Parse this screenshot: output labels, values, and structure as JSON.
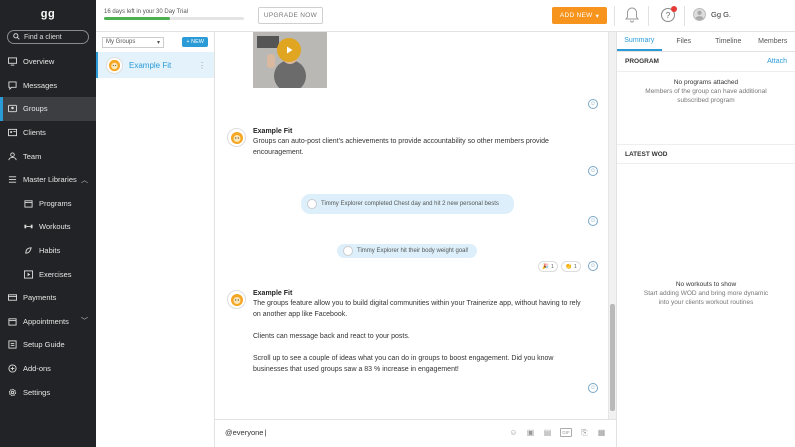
{
  "app": {
    "logo": "gg"
  },
  "nav": {
    "search_placeholder": "Find a client",
    "items": [
      {
        "label": "Overview",
        "icon": "monitor-icon"
      },
      {
        "label": "Messages",
        "icon": "chat-icon"
      },
      {
        "label": "Groups",
        "icon": "groups-icon",
        "active": true
      },
      {
        "label": "Clients",
        "icon": "id-card-icon"
      },
      {
        "label": "Team",
        "icon": "team-icon"
      },
      {
        "label": "Master Libraries",
        "icon": "library-icon",
        "expanded": true
      },
      {
        "label": "Programs",
        "icon": "calendar-icon",
        "sub": true
      },
      {
        "label": "Workouts",
        "icon": "dumbbell-icon",
        "sub": true
      },
      {
        "label": "Habits",
        "icon": "habit-icon",
        "sub": true
      },
      {
        "label": "Exercises",
        "icon": "play-icon",
        "sub": true
      },
      {
        "label": "Payments",
        "icon": "payments-icon"
      },
      {
        "label": "Appointments",
        "icon": "calendar-icon"
      },
      {
        "label": "Setup Guide",
        "icon": "guide-icon"
      },
      {
        "label": "Add-ons",
        "icon": "addons-icon"
      },
      {
        "label": "Settings",
        "icon": "gear-icon"
      }
    ]
  },
  "topbar": {
    "trial_text": "16 days left in your 30 Day Trial",
    "trial_progress": 0.47,
    "upgrade_label": "UPGRADE NOW",
    "add_new_label": "ADD NEW",
    "user_name": "Gg G."
  },
  "groups": {
    "filter_label": "My Groups",
    "new_label": "+ NEW",
    "items": [
      {
        "name": "Example Fit"
      }
    ]
  },
  "feed": {
    "posts": [
      {
        "author": "Example Fit",
        "text": "Groups can auto-post client's achievements to provide accountability so other members provide encouragement."
      },
      {
        "author": "Example Fit",
        "paragraphs": [
          "The groups feature allow you to build digital communities within your Trainerize app, without having to rely on another app like Facebook.",
          "Clients can message back and react to your posts.",
          "Scroll up to see a couple of ideas what you can do in groups to boost engagement. Did you know businesses that used groups saw a 83 % increase in engagement!"
        ]
      }
    ],
    "auto_posts": [
      {
        "text": "Timmy Explorer completed Chest day and hit 2 new personal bests"
      },
      {
        "text": "Timmy Explorer hit their body weight goal!"
      }
    ],
    "reactions": [
      {
        "emoji": "🎉",
        "count": "1"
      },
      {
        "emoji": "👏",
        "count": "1"
      }
    ]
  },
  "composer": {
    "value": "@everyone"
  },
  "right_panel": {
    "tabs": [
      "Summary",
      "Files",
      "Timeline",
      "Members"
    ],
    "active_tab": "Summary",
    "program": {
      "heading": "PROGRAM",
      "attach_label": "Attach",
      "empty_title": "No programs attached",
      "empty_body": "Members of the group can have additional subscribed program"
    },
    "wod": {
      "heading": "LATEST WOD",
      "empty_title": "No workouts to show",
      "empty_body": "Start adding WOD and bring more dynamic into your clients workout routines"
    }
  },
  "colors": {
    "accent": "#2b9bd8",
    "orange": "#f7941d",
    "nav_bg": "#222326",
    "trial_fill": "#4caf50"
  }
}
